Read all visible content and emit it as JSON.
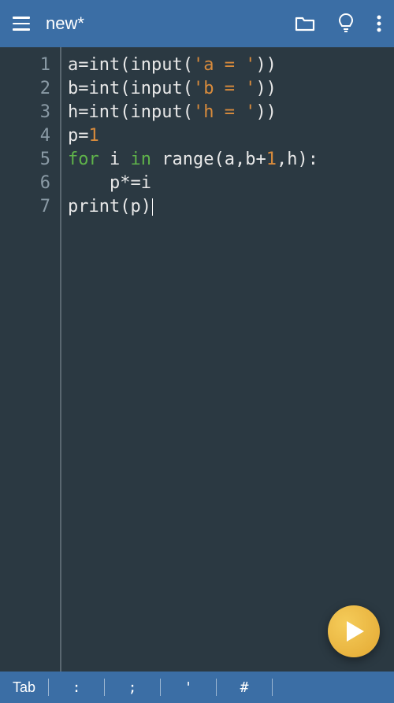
{
  "header": {
    "title": "new*"
  },
  "gutter": {
    "lines": [
      "1",
      "2",
      "3",
      "4",
      "5",
      "6",
      "7"
    ]
  },
  "code": {
    "lines": [
      [
        {
          "t": "a=int(input(",
          "c": "tok-default"
        },
        {
          "t": "'a = '",
          "c": "tok-string"
        },
        {
          "t": "))",
          "c": "tok-default"
        }
      ],
      [
        {
          "t": "b=int(input(",
          "c": "tok-default"
        },
        {
          "t": "'b = '",
          "c": "tok-string"
        },
        {
          "t": "))",
          "c": "tok-default"
        }
      ],
      [
        {
          "t": "h=int(input(",
          "c": "tok-default"
        },
        {
          "t": "'h = '",
          "c": "tok-string"
        },
        {
          "t": "))",
          "c": "tok-default"
        }
      ],
      [
        {
          "t": "p=",
          "c": "tok-default"
        },
        {
          "t": "1",
          "c": "tok-number"
        }
      ],
      [
        {
          "t": "for",
          "c": "tok-keyword"
        },
        {
          "t": " i ",
          "c": "tok-default"
        },
        {
          "t": "in",
          "c": "tok-keyword"
        },
        {
          "t": " range(a,b+",
          "c": "tok-default"
        },
        {
          "t": "1",
          "c": "tok-number"
        },
        {
          "t": ",h):",
          "c": "tok-default"
        }
      ],
      [
        {
          "t": "    p*=i",
          "c": "tok-default"
        }
      ],
      [
        {
          "t": "print(p)",
          "c": "tok-default"
        }
      ]
    ],
    "cursor_line": 6
  },
  "bottombar": {
    "tab": "Tab",
    "colon": ":",
    "semicolon": ";",
    "quote": "'",
    "hash": "#"
  }
}
